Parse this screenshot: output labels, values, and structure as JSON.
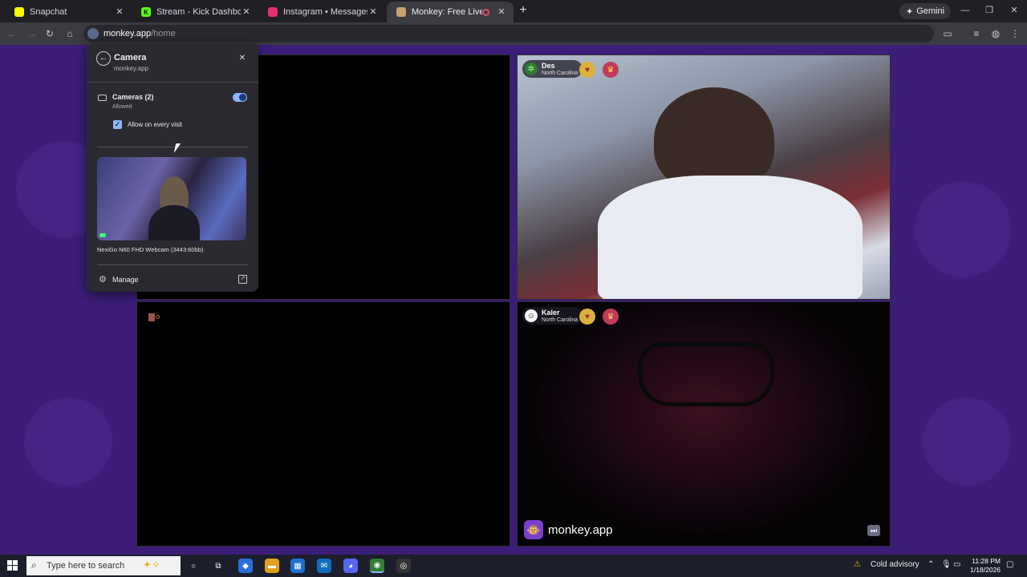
{
  "browser": {
    "tabs": [
      {
        "title": "Snapchat",
        "favicon_color": "#fffc00",
        "active": false
      },
      {
        "title": "Stream - Kick Dashboard",
        "favicon_color": "#53fc18",
        "active": false
      },
      {
        "title": "Instagram • Messages",
        "favicon_color": "#e1306c",
        "active": false
      },
      {
        "title": "Monkey: Free Live Video Ch",
        "favicon_color": "#c9a070",
        "active": true
      }
    ],
    "new_tab_label": "+",
    "gemini_label": "Gemini",
    "url_host": "monkey.app",
    "url_path": "/home"
  },
  "popup": {
    "title": "Camera",
    "subtitle": "monkey.app",
    "cameras_label": "Cameras (2)",
    "cameras_status": "Allowed",
    "toggle_on": true,
    "checkbox_label": "Allow on every visit",
    "checkbox_checked": true,
    "device_name": "NexiGo N60 FHD Webcam (3443:60bb)",
    "manage_label": "Manage"
  },
  "tiles": {
    "top_right": {
      "name": "Des",
      "location": "North Carolina"
    },
    "bottom_right": {
      "name": "Kaler",
      "location": "North Carolina"
    },
    "brand_text": "monkey.app"
  },
  "taskbar": {
    "search_placeholder": "Type here to search",
    "weather": "Cold advisory",
    "time": "11:28 PM",
    "date": "1/18/2026"
  },
  "colors": {
    "page_bg": "#3c1d7a",
    "accent": "#8ab4f8"
  }
}
